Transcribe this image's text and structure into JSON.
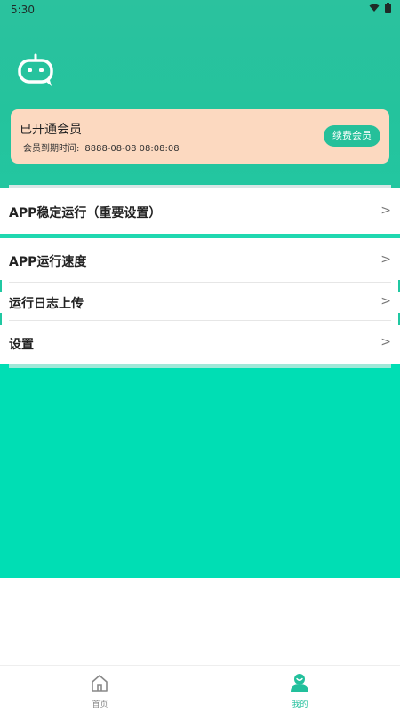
{
  "status_bar": {
    "time": "5:30"
  },
  "vip": {
    "title": "已开通会员",
    "expire_label": "会员到期时间:",
    "expire_value": "8888-08-08 08:08:08",
    "renew_button": "续费会员"
  },
  "menu": {
    "items": [
      {
        "label": "APP稳定运行（重要设置）"
      },
      {
        "label": "APP运行速度"
      },
      {
        "label": "运行日志上传"
      },
      {
        "label": "设置"
      }
    ]
  },
  "tabbar": {
    "tabs": [
      {
        "label": "首页",
        "icon": "home-icon",
        "active": false
      },
      {
        "label": "我的",
        "icon": "user-icon",
        "active": true
      }
    ]
  },
  "colors": {
    "header_green": "#24c39d",
    "vip_card": "#fcd9c0",
    "accent": "#22c09c",
    "content_green": "#00deb4"
  }
}
